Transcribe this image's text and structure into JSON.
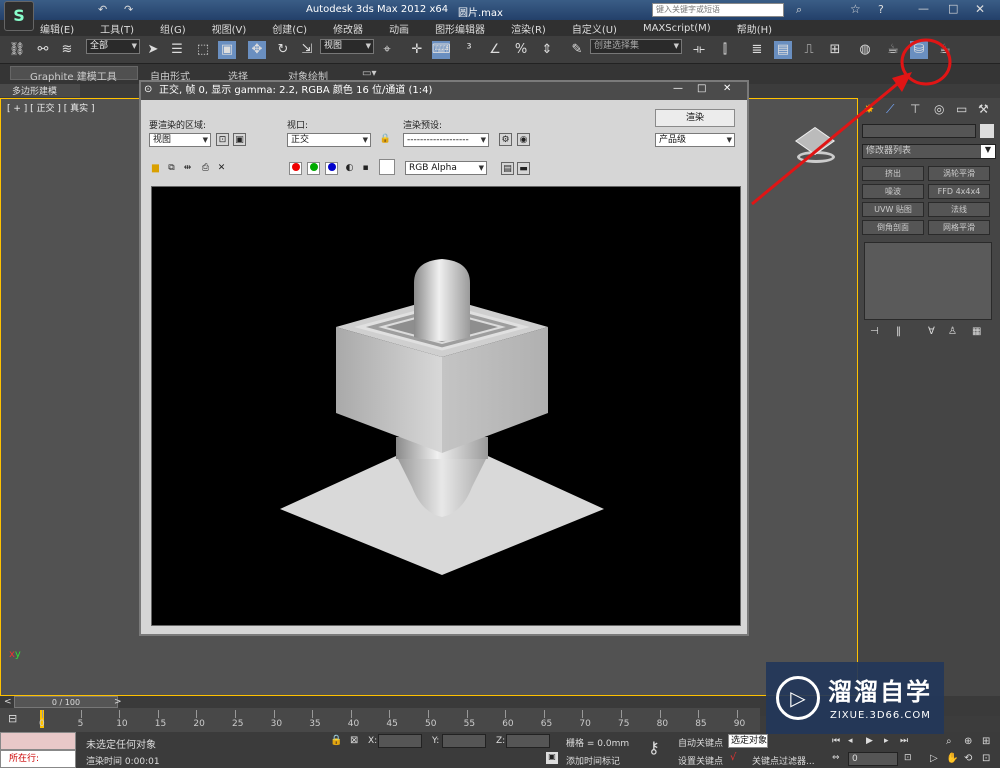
{
  "app": {
    "title": "Autodesk 3ds Max  2012 x64",
    "file": "圆片.max",
    "search_placeholder": "键入关键字或短语"
  },
  "menu": [
    "编辑(E)",
    "工具(T)",
    "组(G)",
    "视图(V)",
    "创建(C)",
    "修改器",
    "动画",
    "图形编辑器",
    "渲染(R)",
    "自定义(U)",
    "MAXScript(M)",
    "帮助(H)"
  ],
  "toolbar": {
    "selection_filter": "全部",
    "ref_coord": "视图",
    "named_selection": "创建选择集"
  },
  "ribbon": {
    "tabs": [
      "Graphite 建模工具",
      "自由形式",
      "选择",
      "对象绘制"
    ],
    "sub": "多边形建模"
  },
  "viewport": {
    "label": "[ + ] [ 正交 ] [ 真实 ]"
  },
  "render_window": {
    "title": "正交, 帧 0, 显示 gamma: 2.2, RGBA 颜色 16 位/通道 (1:4)",
    "area_label": "要渲染的区域:",
    "area_value": "视图",
    "viewport_label": "视口:",
    "viewport_value": "正交",
    "preset_label": "渲染预设:",
    "preset_value": "-------------------",
    "render_button": "渲染",
    "quality_value": "产品级",
    "channel_value": "RGB Alpha"
  },
  "command_panel": {
    "modifier_list": "修改器列表",
    "buttons": [
      "挤出",
      "涡轮平滑",
      "噪波",
      "FFD 4x4x4",
      "UVW 贴图",
      "法线",
      "倒角剖面",
      "网格平滑"
    ]
  },
  "timeline": {
    "frame_label": "0 / 100",
    "ticks": [
      "0",
      "5",
      "10",
      "15",
      "20",
      "25",
      "30",
      "35",
      "40",
      "45",
      "50",
      "55",
      "60",
      "65",
      "70",
      "75",
      "80",
      "85",
      "90"
    ]
  },
  "status": {
    "selection": "未选定任何对象",
    "render_time": "渲染时间  0:00:01",
    "running": "所在行:",
    "x_label": "X:",
    "y_label": "Y:",
    "z_label": "Z:",
    "grid": "栅格 = 0.0mm",
    "add_time_tag": "添加时间标记",
    "auto_key": "自动关键点",
    "selected": "选定对象",
    "set_key": "设置关键点",
    "key_filters": "关键点过滤器...",
    "frame_value": "0"
  },
  "watermark": {
    "title": "溜溜自学",
    "url": "ZIXUE.3D66.COM"
  },
  "colors": {
    "highlight_red": "#e01515",
    "viewport_border": "#ffc200",
    "render_bg": "#000000"
  }
}
